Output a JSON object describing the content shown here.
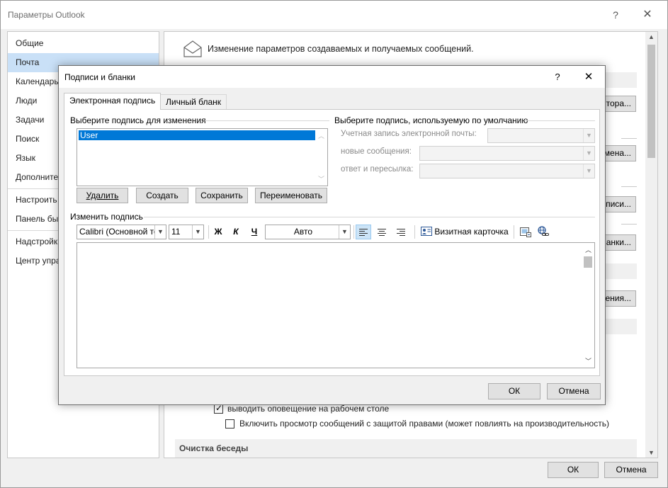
{
  "outer_window": {
    "title": "Параметры Outlook",
    "help": "?",
    "close": "✕",
    "nav": [
      "Общие",
      "Почта",
      "Календарь",
      "Люди",
      "Задачи",
      "Поиск",
      "Язык",
      "Дополните",
      "Настроить",
      "Панель бы",
      "Надстройк",
      "Центр упра"
    ],
    "selected_nav_index": 1,
    "content_header": "Изменение параметров создаваемых и получаемых сообщений.",
    "partial_buttons": [
      "тора...",
      "мена...",
      "писи...",
      "ланки...",
      "мения..."
    ],
    "option_desktop_alert": "выводить оповещение на рабочем столе",
    "option_desktop_alert_checked": true,
    "option_irm_preview": "Включить просмотр сообщений с защитой правами (может повлиять на производительность)",
    "option_irm_preview_checked": false,
    "section_cleanup": "Очистка беседы",
    "ok": "ОК",
    "cancel": "Отмена"
  },
  "dialog": {
    "title": "Подписи и бланки",
    "help": "?",
    "close": "✕",
    "tabs": [
      "Электронная подпись",
      "Личный бланк"
    ],
    "active_tab_index": 0,
    "select_group_label": "Выберите подпись для изменения",
    "signatures": [
      "User"
    ],
    "selected_signature": "User",
    "buttons": {
      "delete": "Удалить",
      "create": "Создать",
      "save": "Сохранить",
      "rename": "Переименовать"
    },
    "default_group_label": "Выберите подпись, используемую по умолчанию",
    "account_label": "Учетная запись электронной почты:",
    "account_value": "",
    "new_messages_label": "новые сообщения:",
    "new_messages_value": "",
    "replies_label": "ответ и пересылка:",
    "replies_value": "",
    "edit_group_label": "Изменить подпись",
    "toolbar": {
      "font": "Calibri (Основной текст)",
      "size": "11",
      "bold": "Ж",
      "italic": "К",
      "underline": "Ч",
      "color": "Авто",
      "business_card": "Визитная карточка",
      "active_align": "left"
    },
    "editor_text": "",
    "ok": "ОК",
    "cancel": "Отмена"
  }
}
